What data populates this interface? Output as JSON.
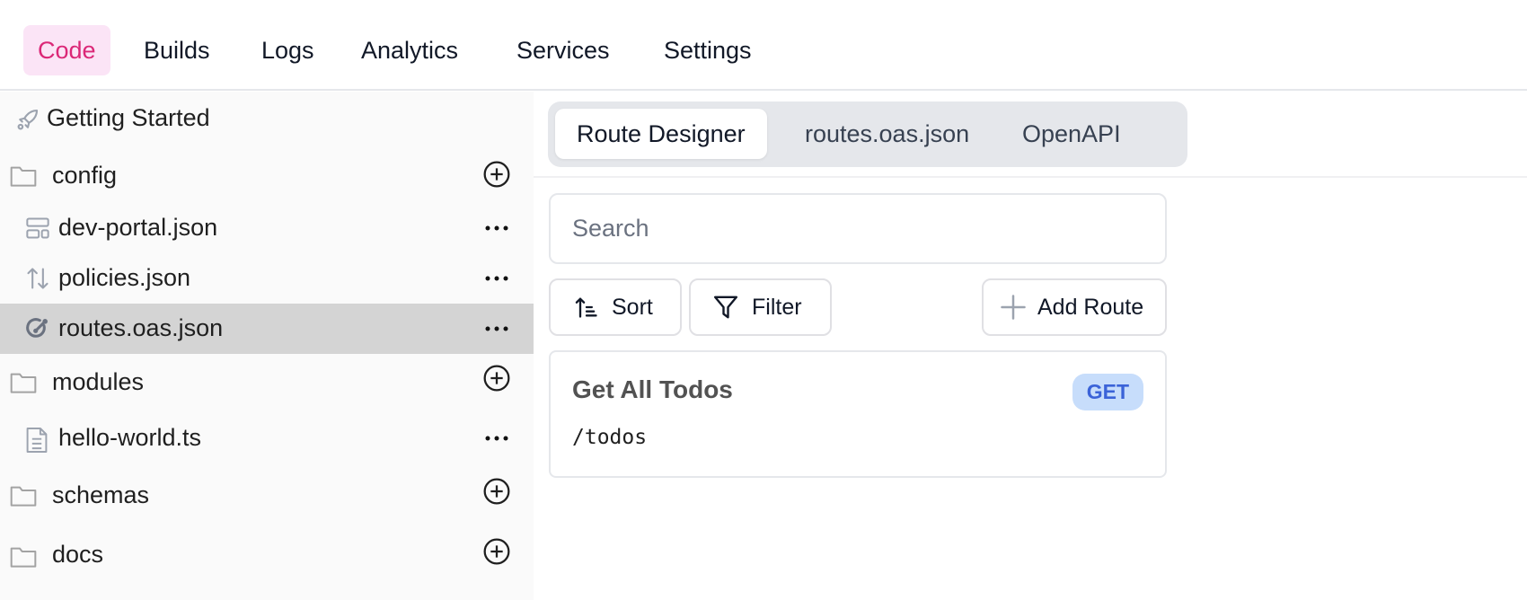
{
  "topnav": {
    "tabs": [
      {
        "label": "Code",
        "active": true
      },
      {
        "label": "Builds",
        "active": false
      },
      {
        "label": "Logs",
        "active": false
      },
      {
        "label": "Analytics",
        "active": false
      },
      {
        "label": "Services",
        "active": false
      },
      {
        "label": "Settings",
        "active": false
      }
    ]
  },
  "sidebar": {
    "getting_started": {
      "label": "Getting Started",
      "icon": "rocket-icon"
    },
    "items": [
      {
        "type": "folder",
        "label": "config",
        "icon": "folder-icon",
        "action": "add-icon"
      },
      {
        "type": "file",
        "label": "dev-portal.json",
        "icon": "layout-icon",
        "action": "more-icon"
      },
      {
        "type": "file",
        "label": "policies.json",
        "icon": "arrows-up-down-icon",
        "action": "more-icon"
      },
      {
        "type": "file",
        "label": "routes.oas.json",
        "icon": "route-icon",
        "action": "more-icon",
        "selected": true
      },
      {
        "type": "folder",
        "label": "modules",
        "icon": "folder-icon",
        "action": "add-icon"
      },
      {
        "type": "file",
        "label": "hello-world.ts",
        "icon": "file-text-icon",
        "action": "more-icon"
      },
      {
        "type": "folder",
        "label": "schemas",
        "icon": "folder-icon",
        "action": "add-icon"
      },
      {
        "type": "folder",
        "label": "docs",
        "icon": "folder-icon",
        "action": "add-icon"
      }
    ]
  },
  "main": {
    "tabs": [
      {
        "label": "Route Designer",
        "active": true
      },
      {
        "label": "routes.oas.json",
        "active": false
      },
      {
        "label": "OpenAPI",
        "active": false
      }
    ],
    "search": {
      "placeholder": "Search",
      "value": ""
    },
    "toolbar": {
      "sort_label": "Sort",
      "filter_label": "Filter",
      "add_route_label": "Add Route"
    },
    "routes": [
      {
        "title": "Get All Todos",
        "method": "GET",
        "path": "/todos"
      }
    ]
  },
  "colors": {
    "accent": "#db2777",
    "accent_bg": "#fbe4f6",
    "get_badge_bg": "#c7ddfb",
    "get_badge_text": "#3b63d8",
    "selected_row": "#d4d4d4"
  }
}
